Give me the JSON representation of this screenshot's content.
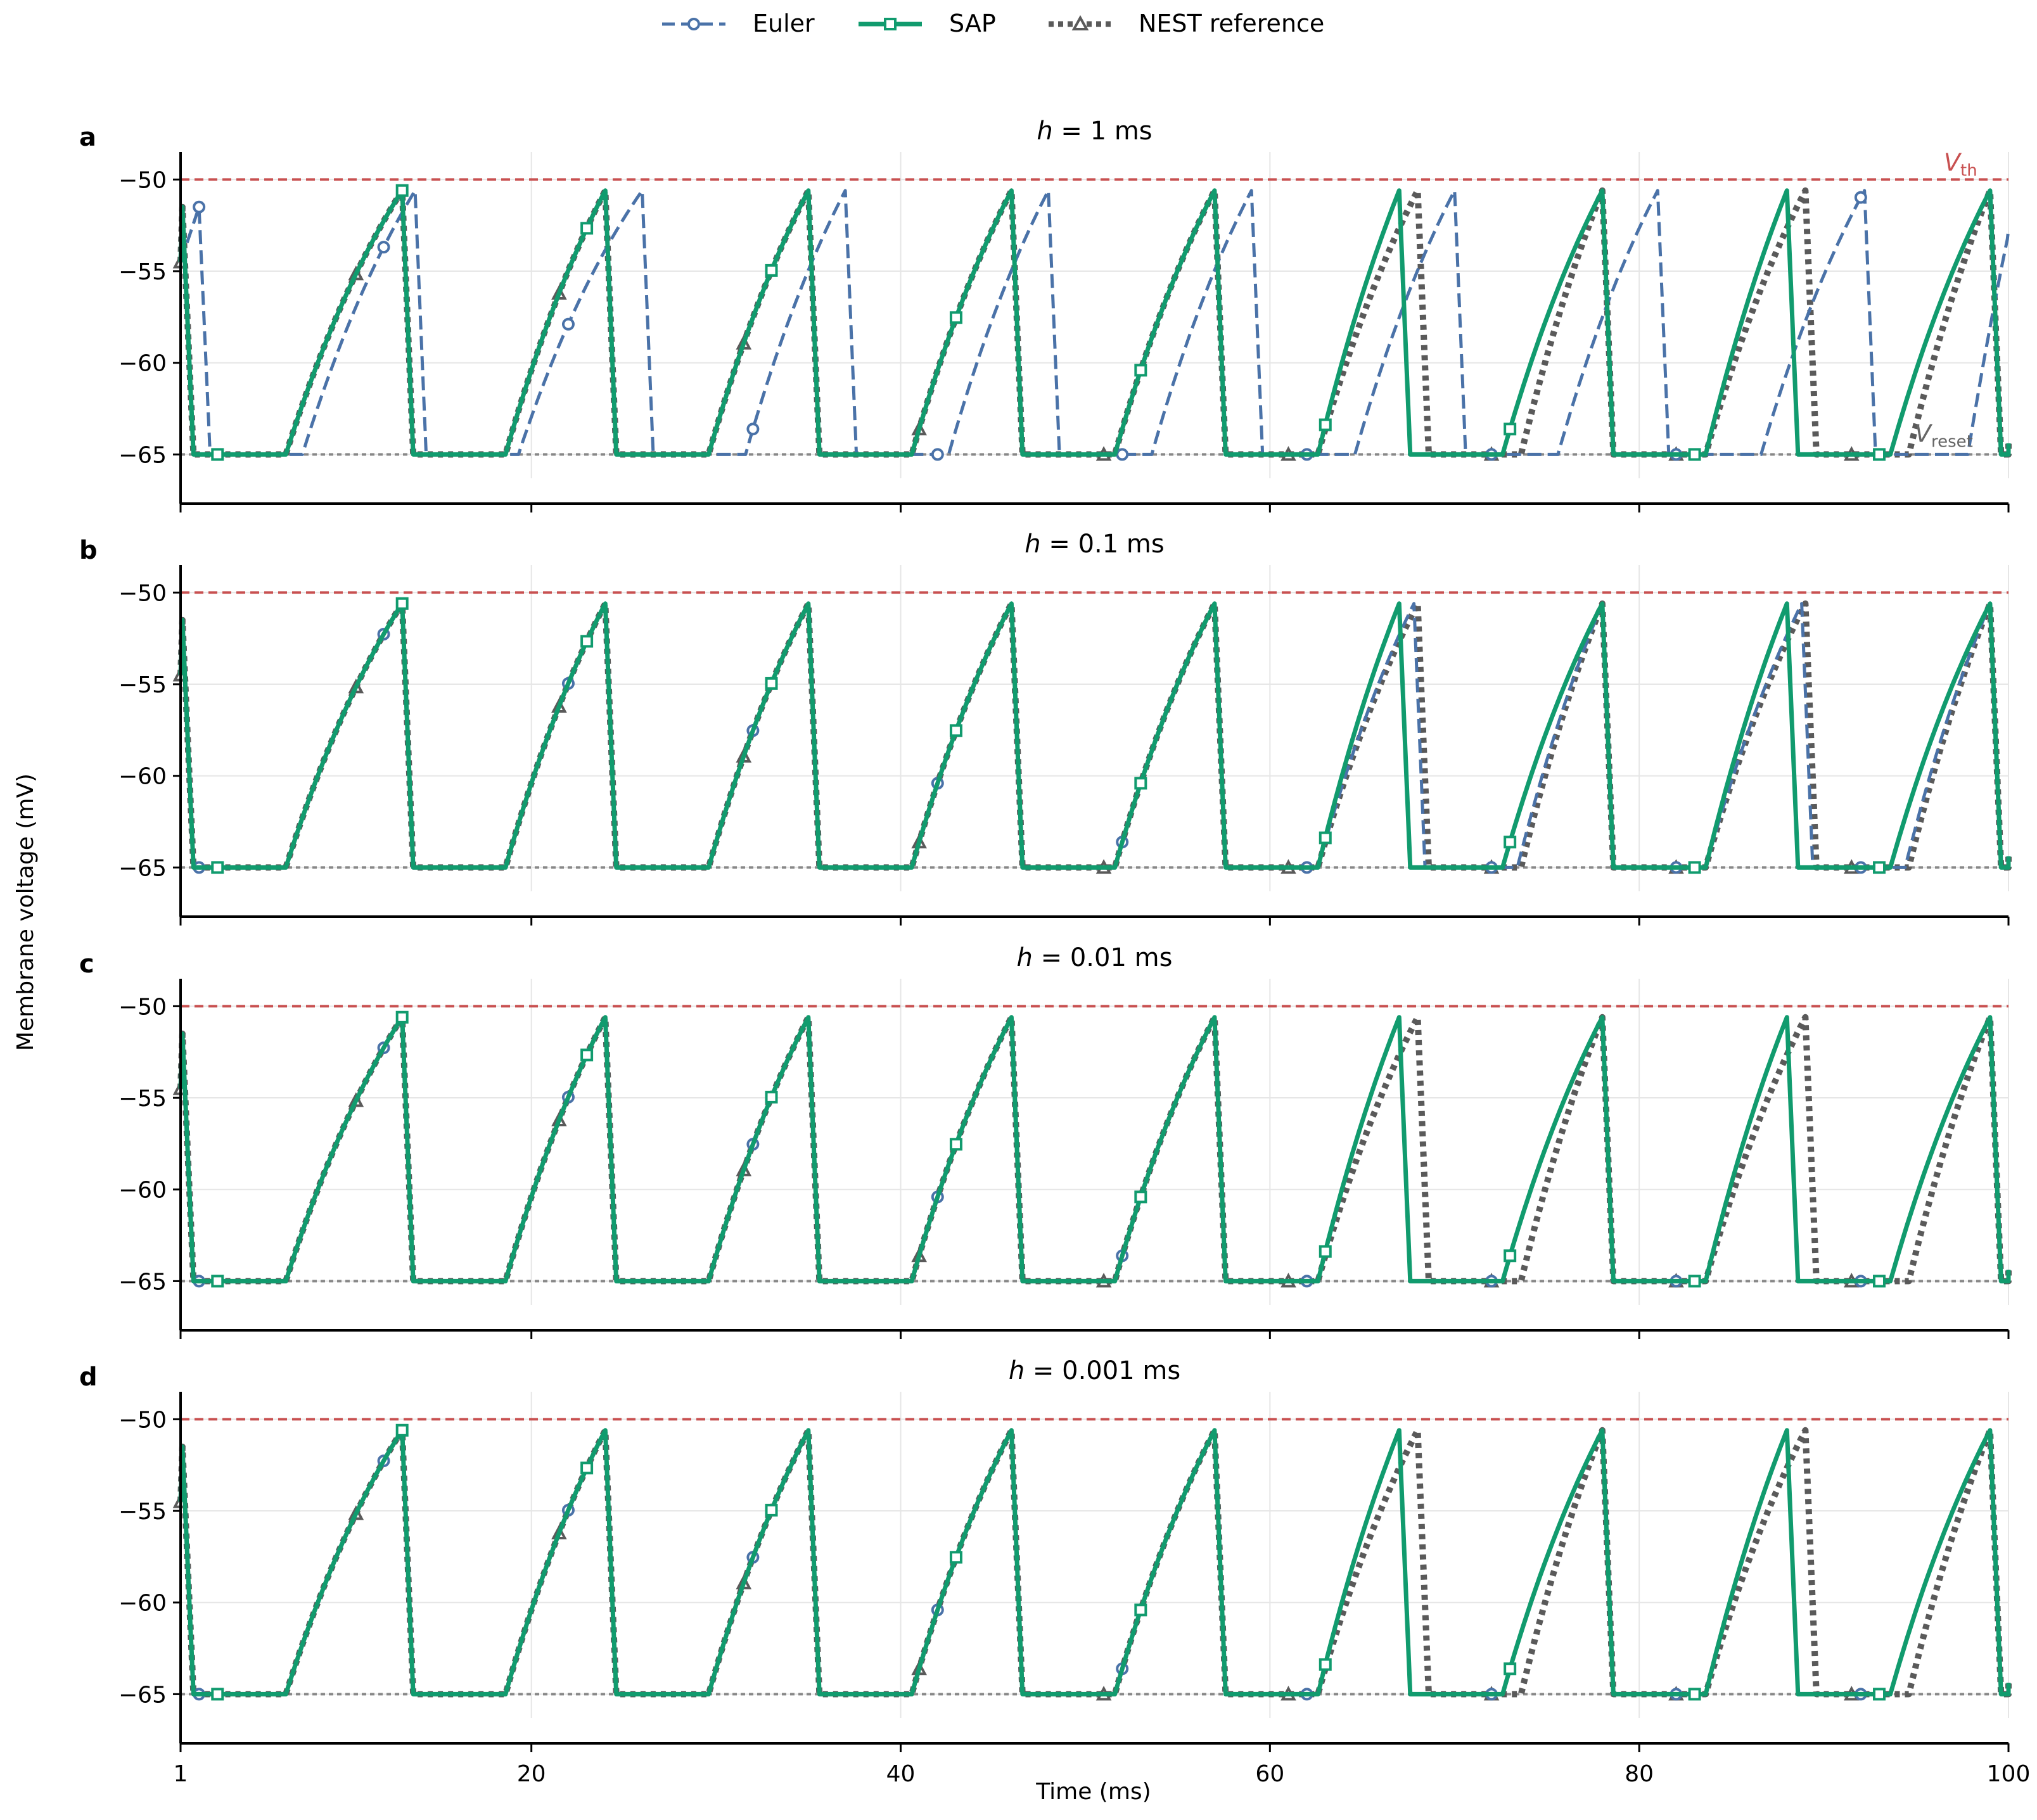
{
  "legend": {
    "euler": "Euler",
    "sap": "SAP",
    "nest": "NEST reference"
  },
  "colors": {
    "euler": "#4a72a8",
    "sap": "#119b6e",
    "nest": "#5a5a5a",
    "threshold": "#c85050",
    "reset": "#888888"
  },
  "figure": {
    "ylabel": "Membrane voltage (mV)",
    "xlabel": "Time (ms)"
  },
  "threshold_labels": {
    "vth_main": "V",
    "vth_sub": "th",
    "vreset_main": "V",
    "vreset_sub": "reset"
  },
  "chart_data": [
    {
      "type": "line",
      "panel": "a",
      "title_h": "h",
      "title_value": " = 1 ms",
      "h": 1,
      "xlim": [
        1,
        100
      ],
      "ylim": [
        -66.3,
        -48.5
      ],
      "xticks": [
        1,
        20,
        40,
        60,
        80,
        100
      ],
      "yticks": [
        -50,
        -55,
        -60,
        -65
      ],
      "v_threshold": -50,
      "v_reset": -65,
      "euler_spikes": [
        2.0,
        13.7,
        26.0,
        37.0,
        48.0,
        59.0,
        70.0,
        81.0,
        92.2
      ],
      "sap_spikes": [
        1.1,
        13.0,
        24.0,
        35.0,
        46.0,
        57.0,
        67.0,
        78.0,
        88.0,
        99.0
      ],
      "nest_spikes": [
        1.1,
        13.0,
        24.0,
        35.0,
        46.0,
        57.0,
        68.0,
        78.0,
        89.0,
        99.0
      ]
    },
    {
      "type": "line",
      "panel": "b",
      "title_h": "h",
      "title_value": " = 0.1 ms",
      "h": 0.1,
      "xlim": [
        1,
        100
      ],
      "ylim": [
        -66.3,
        -48.5
      ],
      "xticks": [
        1,
        20,
        40,
        60,
        80,
        100
      ],
      "yticks": [
        -50,
        -55,
        -60,
        -65
      ],
      "v_threshold": -50,
      "v_reset": -65,
      "euler_spikes": [
        1.1,
        13.0,
        24.0,
        35.0,
        46.0,
        57.0,
        67.8,
        78.0,
        88.8,
        99.0
      ],
      "sap_spikes": [
        1.1,
        13.0,
        24.0,
        35.0,
        46.0,
        57.0,
        67.0,
        78.0,
        88.0,
        99.0
      ],
      "nest_spikes": [
        1.1,
        13.0,
        24.0,
        35.0,
        46.0,
        57.0,
        68.0,
        78.0,
        89.0,
        99.0
      ]
    },
    {
      "type": "line",
      "panel": "c",
      "title_h": "h",
      "title_value": " = 0.01 ms",
      "h": 0.01,
      "xlim": [
        1,
        100
      ],
      "ylim": [
        -66.3,
        -48.5
      ],
      "xticks": [
        1,
        20,
        40,
        60,
        80,
        100
      ],
      "yticks": [
        -50,
        -55,
        -60,
        -65
      ],
      "v_threshold": -50,
      "v_reset": -65,
      "euler_spikes": [
        1.1,
        13.0,
        24.0,
        35.0,
        46.0,
        57.0,
        67.0,
        78.0,
        88.0,
        99.0
      ],
      "sap_spikes": [
        1.1,
        13.0,
        24.0,
        35.0,
        46.0,
        57.0,
        67.0,
        78.0,
        88.0,
        99.0
      ],
      "nest_spikes": [
        1.1,
        13.0,
        24.0,
        35.0,
        46.0,
        57.0,
        68.0,
        78.0,
        89.0,
        99.0
      ]
    },
    {
      "type": "line",
      "panel": "d",
      "title_h": "h",
      "title_value": " = 0.001 ms",
      "h": 0.001,
      "xlim": [
        1,
        100
      ],
      "ylim": [
        -66.3,
        -48.5
      ],
      "xticks": [
        1,
        20,
        40,
        60,
        80,
        100
      ],
      "yticks": [
        -50,
        -55,
        -60,
        -65
      ],
      "v_threshold": -50,
      "v_reset": -65,
      "euler_spikes": [
        1.1,
        13.0,
        24.0,
        35.0,
        46.0,
        57.0,
        67.0,
        78.0,
        88.0,
        99.0
      ],
      "sap_spikes": [
        1.1,
        13.0,
        24.0,
        35.0,
        46.0,
        57.0,
        67.0,
        78.0,
        88.0,
        99.0
      ],
      "nest_spikes": [
        1.1,
        13.0,
        24.0,
        35.0,
        46.0,
        57.0,
        68.0,
        78.0,
        89.0,
        99.0
      ]
    }
  ]
}
